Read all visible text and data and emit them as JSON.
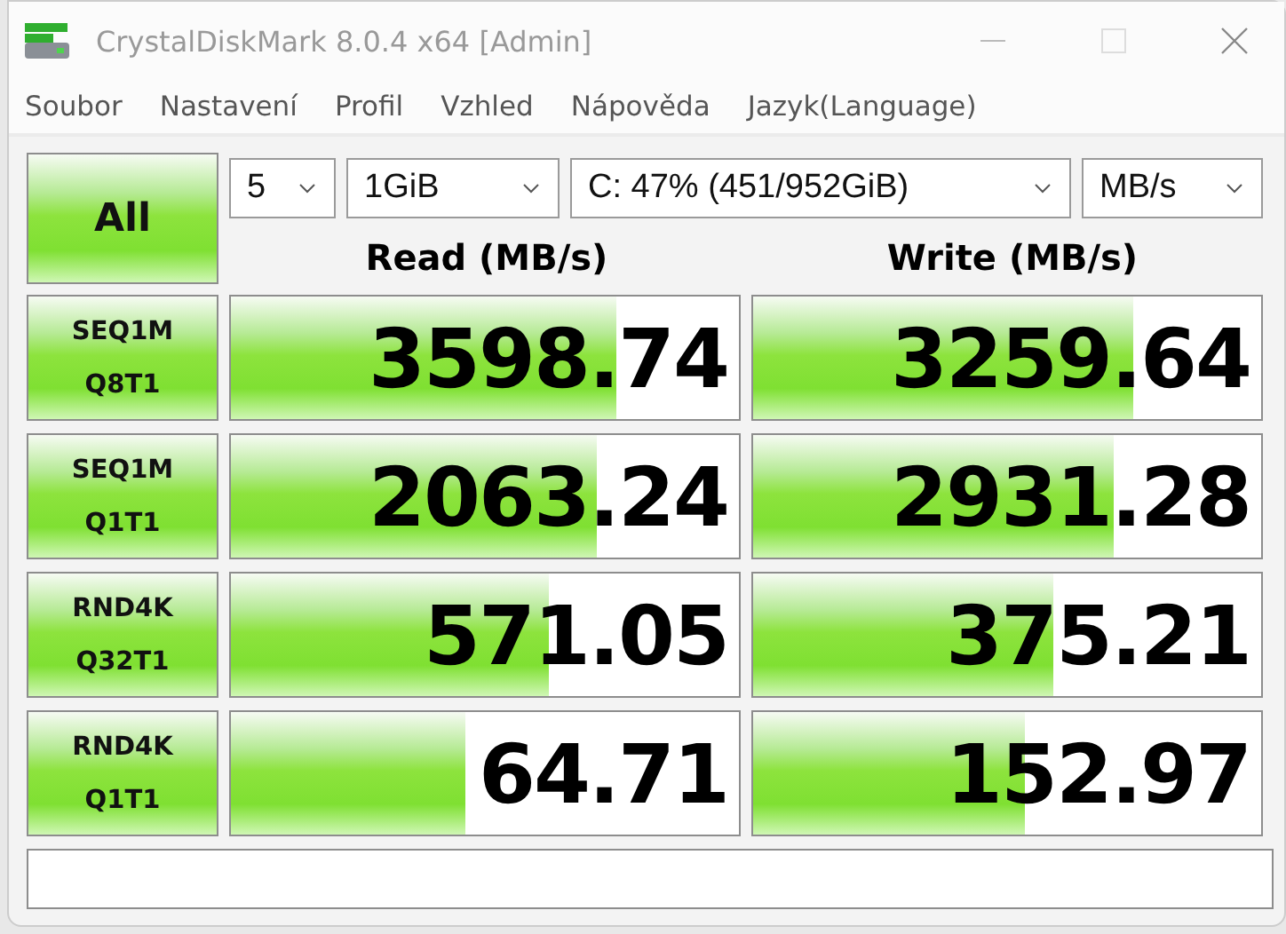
{
  "window": {
    "title": "CrystalDiskMark 8.0.4 x64 [Admin]"
  },
  "menu": [
    "Soubor",
    "Nastavení",
    "Profil",
    "Vzhled",
    "Nápověda",
    "Jazyk(Language)"
  ],
  "all_button": "All",
  "selects": [
    {
      "value": "5"
    },
    {
      "value": "1GiB"
    },
    {
      "value": "C: 47% (451/952GiB)"
    },
    {
      "value": "MB/s"
    }
  ],
  "headers": {
    "read": "Read (MB/s)",
    "write": "Write (MB/s)"
  },
  "rows": [
    {
      "label": [
        "SEQ1M",
        "Q8T1"
      ],
      "read": {
        "value": "3598.74",
        "level": 0.757
      },
      "write": {
        "value": "3259.64",
        "level": 0.747
      }
    },
    {
      "label": [
        "SEQ1M",
        "Q1T1"
      ],
      "read": {
        "value": "2063.24",
        "level": 0.72
      },
      "write": {
        "value": "2931.28",
        "level": 0.71
      }
    },
    {
      "label": [
        "RND4K",
        "Q32T1"
      ],
      "read": {
        "value": "571.05",
        "level": 0.625
      },
      "write": {
        "value": "375.21",
        "level": 0.59
      }
    },
    {
      "label": [
        "RND4K",
        "Q1T1"
      ],
      "read": {
        "value": "64.71",
        "level": 0.46
      },
      "write": {
        "value": "152.97",
        "level": 0.535
      }
    }
  ]
}
